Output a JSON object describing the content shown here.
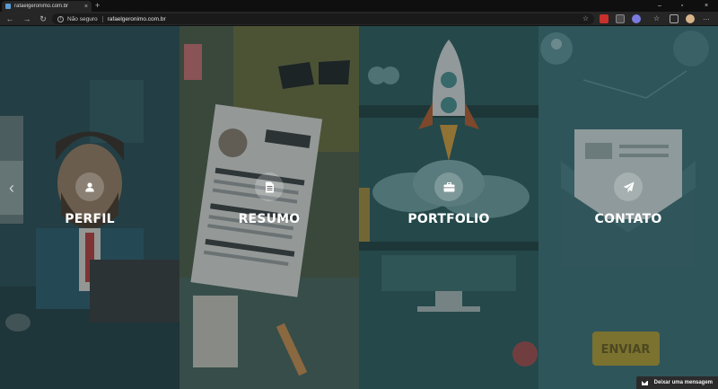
{
  "browser": {
    "tab_title": "rafaelgeronimo.com.br",
    "tab_close": "×",
    "new_tab": "+",
    "security_label": "Não seguro",
    "url": "rafaelgeronimo.com.br",
    "window_controls": [
      "–",
      "▫",
      "×"
    ]
  },
  "panels": [
    {
      "label": "PERFIL",
      "icon": "user-icon",
      "bg": "#2e4e55"
    },
    {
      "label": "RESUMO",
      "icon": "document-icon",
      "bg": "#5a5f48"
    },
    {
      "label": "PORTFOLIO",
      "icon": "briefcase-icon",
      "bg": "#2f5a5a"
    },
    {
      "label": "CONTATO",
      "icon": "paper-plane-icon",
      "bg": "#35636a"
    }
  ],
  "message_button": {
    "label": "Deixar uma mensagem",
    "icon": "mail-icon"
  }
}
